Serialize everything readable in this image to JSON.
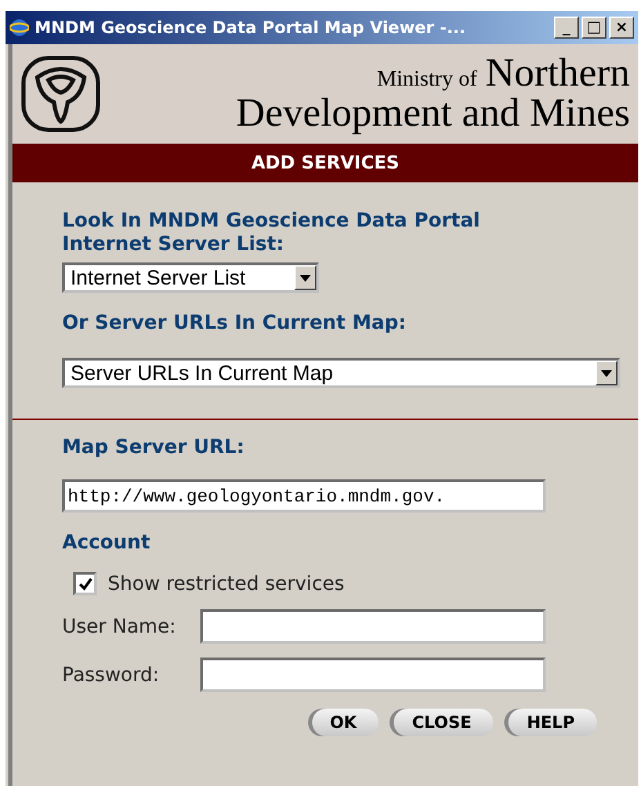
{
  "window": {
    "title": "MNDM Geoscience Data Portal Map Viewer -...",
    "controls": [
      "_",
      "□",
      "×"
    ]
  },
  "header": {
    "ministry_of": "Ministry of",
    "northern": "Northern",
    "line2": "Development and Mines"
  },
  "banner": "ADD SERVICES",
  "server_list": {
    "label": "Look In MNDM Geoscience Data Portal Internet Server List:",
    "value": "Internet Server List"
  },
  "current_map": {
    "label": "Or Server URLs In Current Map:",
    "value": "Server URLs In Current Map"
  },
  "map_server_url": {
    "label": "Map Server URL:",
    "value": "http://www.geologyontario.mndm.gov."
  },
  "account": {
    "heading": "Account",
    "show_restricted": {
      "label": "Show restricted services",
      "checked": true
    },
    "fields": [
      {
        "label": "User Name:"
      },
      {
        "label": "Password:"
      }
    ]
  },
  "buttons": [
    "OK",
    "CLOSE",
    "HELP"
  ]
}
